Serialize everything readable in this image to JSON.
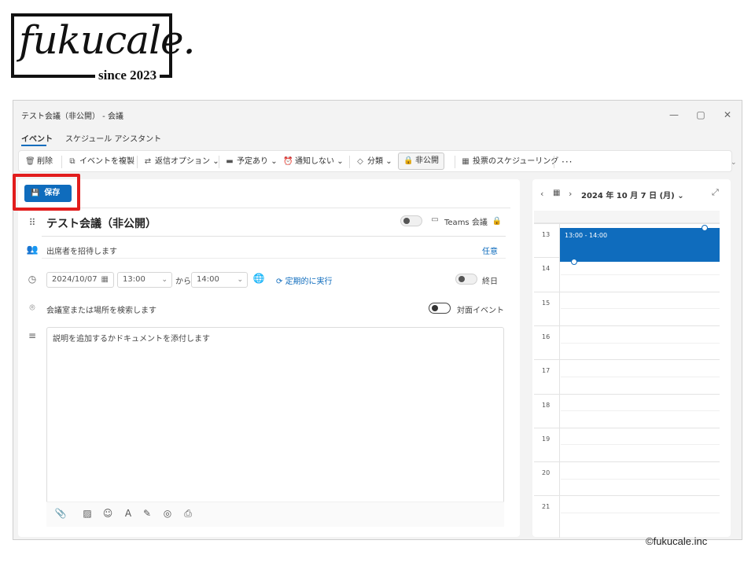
{
  "logo": {
    "script_text": "fukucale.",
    "since_text": "since 2023"
  },
  "window": {
    "title": "テスト会議（非公開） - 会議",
    "controls": {
      "minimize": "—",
      "maximize": "▢",
      "close": "✕"
    }
  },
  "tabs": [
    {
      "label": "イベント",
      "active": true
    },
    {
      "label": "スケジュール アシスタント",
      "active": false
    }
  ],
  "toolbar": {
    "delete": "削除",
    "duplicate": "イベントを複製",
    "reply_options": "返信オプション",
    "busy": "予定あり",
    "no_reminder": "通知しない",
    "categorize": "分類",
    "private": "非公開",
    "poll": "投票のスケジューリング",
    "more": "···"
  },
  "form": {
    "save": "保存",
    "title": "テスト会議（非公開）",
    "teams": "Teams 会議",
    "invite_placeholder": "出席者を招待します",
    "optional": "任意",
    "start_date": "2024/10/07",
    "start_time": "13:00",
    "to": "から",
    "end_time": "14:00",
    "recurring": "定期的に実行",
    "all_day": "終日",
    "location_placeholder": "会議室または場所を検索します",
    "in_person": "対面イベント",
    "description_placeholder": "説明を追加するかドキュメントを添付します"
  },
  "calendar": {
    "date_header": "2024 年 10 月 7 日 (月)",
    "hours": [
      "13",
      "14",
      "15",
      "16",
      "17",
      "18",
      "19",
      "20",
      "21"
    ],
    "event_time": "13:00 - 14:00"
  },
  "icons": {
    "delete": "trash-icon",
    "duplicate": "copy-icon",
    "reply": "reply-options-icon",
    "busy": "calendar-status-icon",
    "reminder": "alarm-icon",
    "category": "tag-icon",
    "private": "lock-icon",
    "poll": "poll-icon",
    "save": "floppy-icon"
  },
  "colors": {
    "accent": "#0f6cbd",
    "highlight": "#e21d1d"
  },
  "copyright": "©fukucale.inc"
}
